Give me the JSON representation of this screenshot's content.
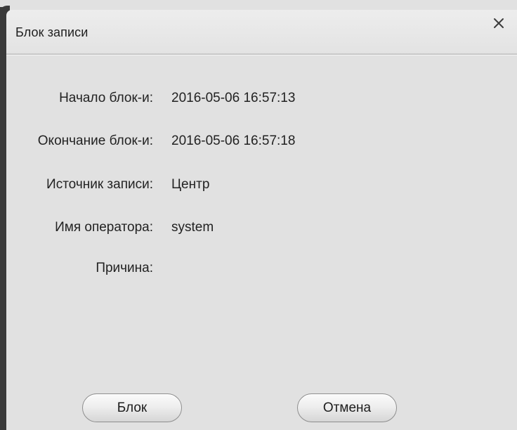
{
  "dialog": {
    "title": "Блок записи",
    "close_icon": "close-icon"
  },
  "fields": [
    {
      "label": "Начало блок-и:",
      "value": "2016-05-06  16:57:13"
    },
    {
      "label": "Окончание блок-и:",
      "value": "2016-05-06  16:57:18"
    },
    {
      "label": "Источник записи:",
      "value": "Центр"
    },
    {
      "label": "Имя оператора:",
      "value": "system"
    },
    {
      "label": "Причина:",
      "value": ""
    }
  ],
  "buttons": {
    "block_label": "Блок",
    "cancel_label": "Отмена"
  },
  "colors": {
    "dialog_background": "#e1e1e1",
    "frame_dark": "#3a3a3a",
    "button_border": "#8e8e8e"
  }
}
